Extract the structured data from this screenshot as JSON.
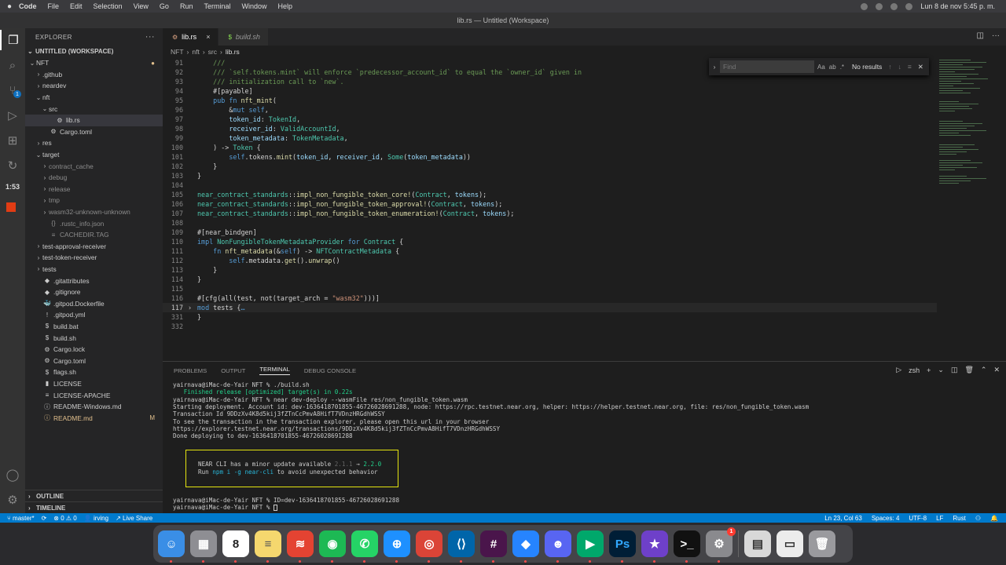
{
  "menubar": {
    "app": "Code",
    "items": [
      "File",
      "Edit",
      "Selection",
      "View",
      "Go",
      "Run",
      "Terminal",
      "Window",
      "Help"
    ],
    "clock": "Lun 8 de nov  5:45 p. m."
  },
  "window": {
    "title": "lib.rs — Untitled (Workspace)"
  },
  "activity": {
    "timer": "1:53",
    "scm_badge": "1"
  },
  "explorer": {
    "header": "EXPLORER",
    "workspace": "UNTITLED (WORKSPACE)",
    "tree": [
      {
        "label": "NFT",
        "indent": 0,
        "chev": "⌄",
        "icon": "",
        "mark": "●"
      },
      {
        "label": ".github",
        "indent": 1,
        "chev": "›",
        "icon": ""
      },
      {
        "label": "neardev",
        "indent": 1,
        "chev": "›",
        "icon": ""
      },
      {
        "label": "nft",
        "indent": 1,
        "chev": "⌄",
        "icon": ""
      },
      {
        "label": "src",
        "indent": 2,
        "chev": "⌄",
        "icon": ""
      },
      {
        "label": "lib.rs",
        "indent": 3,
        "chev": "",
        "icon": "⚙",
        "selected": true
      },
      {
        "label": "Cargo.toml",
        "indent": 2,
        "chev": "",
        "icon": "⚙"
      },
      {
        "label": "res",
        "indent": 1,
        "chev": "›",
        "icon": ""
      },
      {
        "label": "target",
        "indent": 1,
        "chev": "⌄",
        "icon": ""
      },
      {
        "label": "contract_cache",
        "indent": 2,
        "chev": "›",
        "icon": "",
        "dim": true
      },
      {
        "label": "debug",
        "indent": 2,
        "chev": "›",
        "icon": "",
        "dim": true
      },
      {
        "label": "release",
        "indent": 2,
        "chev": "›",
        "icon": "",
        "dim": true
      },
      {
        "label": "tmp",
        "indent": 2,
        "chev": "›",
        "icon": "",
        "dim": true
      },
      {
        "label": "wasm32-unknown-unknown",
        "indent": 2,
        "chev": "›",
        "icon": "",
        "dim": true
      },
      {
        "label": ".rustc_info.json",
        "indent": 2,
        "chev": "",
        "icon": "{}",
        "dim": true
      },
      {
        "label": "CACHEDIR.TAG",
        "indent": 2,
        "chev": "",
        "icon": "≡",
        "dim": true
      },
      {
        "label": "test-approval-receiver",
        "indent": 1,
        "chev": "›",
        "icon": ""
      },
      {
        "label": "test-token-receiver",
        "indent": 1,
        "chev": "›",
        "icon": ""
      },
      {
        "label": "tests",
        "indent": 1,
        "chev": "›",
        "icon": ""
      },
      {
        "label": ".gitattributes",
        "indent": 1,
        "chev": "",
        "icon": "◆"
      },
      {
        "label": ".gitignore",
        "indent": 1,
        "chev": "",
        "icon": "◆"
      },
      {
        "label": ".gitpod.Dockerfile",
        "indent": 1,
        "chev": "",
        "icon": "🐳"
      },
      {
        "label": ".gitpod.yml",
        "indent": 1,
        "chev": "",
        "icon": "!"
      },
      {
        "label": "build.bat",
        "indent": 1,
        "chev": "",
        "icon": "$"
      },
      {
        "label": "build.sh",
        "indent": 1,
        "chev": "",
        "icon": "$"
      },
      {
        "label": "Cargo.lock",
        "indent": 1,
        "chev": "",
        "icon": "⚙"
      },
      {
        "label": "Cargo.toml",
        "indent": 1,
        "chev": "",
        "icon": "⚙"
      },
      {
        "label": "flags.sh",
        "indent": 1,
        "chev": "",
        "icon": "$"
      },
      {
        "label": "LICENSE",
        "indent": 1,
        "chev": "",
        "icon": "▮"
      },
      {
        "label": "LICENSE-APACHE",
        "indent": 1,
        "chev": "",
        "icon": "≡"
      },
      {
        "label": "README-Windows.md",
        "indent": 1,
        "chev": "",
        "icon": "ⓘ"
      },
      {
        "label": "README.md",
        "indent": 1,
        "chev": "",
        "icon": "ⓘ",
        "mod": true,
        "mark": "M"
      }
    ],
    "outline": "OUTLINE",
    "timeline": "TIMELINE"
  },
  "editor": {
    "tabs": [
      {
        "label": "lib.rs",
        "active": true,
        "close": "×"
      },
      {
        "label": "build.sh",
        "active": false
      }
    ],
    "breadcrumb": [
      "NFT",
      "nft",
      "src",
      "lib.rs"
    ],
    "find": {
      "placeholder": "Find",
      "result": "No results",
      "opts": [
        "Aa",
        "ab",
        ".*"
      ]
    },
    "lines": [
      {
        "n": "91",
        "segs": [
          [
            "c-com",
            "    ///"
          ]
        ]
      },
      {
        "n": "92",
        "segs": [
          [
            "c-com",
            "    /// `self.tokens.mint` will enforce `predecessor_account_id` to equal the `owner_id` given in"
          ]
        ]
      },
      {
        "n": "93",
        "segs": [
          [
            "c-com",
            "    /// initialization call to `new`."
          ]
        ]
      },
      {
        "n": "94",
        "segs": [
          [
            "c-pl",
            "    #[payable]"
          ]
        ]
      },
      {
        "n": "95",
        "segs": [
          [
            "c-kw",
            "    pub fn "
          ],
          [
            "c-fn",
            "nft_mint"
          ],
          [
            "c-pl",
            "("
          ]
        ]
      },
      {
        "n": "96",
        "segs": [
          [
            "c-pl",
            "        &"
          ],
          [
            "c-kw",
            "mut self"
          ],
          [
            "c-pl",
            ","
          ]
        ]
      },
      {
        "n": "97",
        "segs": [
          [
            "c-var",
            "        token_id"
          ],
          [
            "c-pl",
            ": "
          ],
          [
            "c-ty",
            "TokenId"
          ],
          [
            "c-pl",
            ","
          ]
        ]
      },
      {
        "n": "98",
        "segs": [
          [
            "c-var",
            "        receiver_id"
          ],
          [
            "c-pl",
            ": "
          ],
          [
            "c-ty",
            "ValidAccountId"
          ],
          [
            "c-pl",
            ","
          ]
        ]
      },
      {
        "n": "99",
        "segs": [
          [
            "c-var",
            "        token_metadata"
          ],
          [
            "c-pl",
            ": "
          ],
          [
            "c-ty",
            "TokenMetadata"
          ],
          [
            "c-pl",
            ","
          ]
        ]
      },
      {
        "n": "100",
        "segs": [
          [
            "c-pl",
            "    ) -> "
          ],
          [
            "c-ty",
            "Token"
          ],
          [
            "c-pl",
            " {"
          ]
        ]
      },
      {
        "n": "101",
        "segs": [
          [
            "c-kw",
            "        self"
          ],
          [
            "c-pl",
            ".tokens."
          ],
          [
            "c-fn",
            "mint"
          ],
          [
            "c-pl",
            "("
          ],
          [
            "c-var",
            "token_id"
          ],
          [
            "c-pl",
            ", "
          ],
          [
            "c-var",
            "receiver_id"
          ],
          [
            "c-pl",
            ", "
          ],
          [
            "c-ty",
            "Some"
          ],
          [
            "c-pl",
            "("
          ],
          [
            "c-var",
            "token_metadata"
          ],
          [
            "c-pl",
            "))"
          ]
        ]
      },
      {
        "n": "102",
        "segs": [
          [
            "c-pl",
            "    }"
          ]
        ]
      },
      {
        "n": "103",
        "segs": [
          [
            "c-pl",
            "}"
          ]
        ]
      },
      {
        "n": "104",
        "segs": []
      },
      {
        "n": "105",
        "segs": [
          [
            "c-ty",
            "near_contract_standards"
          ],
          [
            "c-pl",
            "::"
          ],
          [
            "c-fn",
            "impl_non_fungible_token_core!"
          ],
          [
            "c-pl",
            "("
          ],
          [
            "c-ty",
            "Contract"
          ],
          [
            "c-pl",
            ", "
          ],
          [
            "c-var",
            "tokens"
          ],
          [
            "c-pl",
            ");"
          ]
        ]
      },
      {
        "n": "106",
        "segs": [
          [
            "c-ty",
            "near_contract_standards"
          ],
          [
            "c-pl",
            "::"
          ],
          [
            "c-fn",
            "impl_non_fungible_token_approval!"
          ],
          [
            "c-pl",
            "("
          ],
          [
            "c-ty",
            "Contract"
          ],
          [
            "c-pl",
            ", "
          ],
          [
            "c-var",
            "tokens"
          ],
          [
            "c-pl",
            ");"
          ]
        ]
      },
      {
        "n": "107",
        "segs": [
          [
            "c-ty",
            "near_contract_standards"
          ],
          [
            "c-pl",
            "::"
          ],
          [
            "c-fn",
            "impl_non_fungible_token_enumeration!"
          ],
          [
            "c-pl",
            "("
          ],
          [
            "c-ty",
            "Contract"
          ],
          [
            "c-pl",
            ", "
          ],
          [
            "c-var",
            "tokens"
          ],
          [
            "c-pl",
            ");"
          ]
        ]
      },
      {
        "n": "108",
        "segs": []
      },
      {
        "n": "109",
        "segs": [
          [
            "c-pl",
            "#[near_bindgen]"
          ]
        ]
      },
      {
        "n": "110",
        "segs": [
          [
            "c-kw",
            "impl "
          ],
          [
            "c-ty",
            "NonFungibleTokenMetadataProvider"
          ],
          [
            "c-kw",
            " for "
          ],
          [
            "c-ty",
            "Contract"
          ],
          [
            "c-pl",
            " {"
          ]
        ]
      },
      {
        "n": "111",
        "segs": [
          [
            "c-kw",
            "    fn "
          ],
          [
            "c-fn",
            "nft_metadata"
          ],
          [
            "c-pl",
            "(&"
          ],
          [
            "c-kw",
            "self"
          ],
          [
            "c-pl",
            ") -> "
          ],
          [
            "c-ty",
            "NFTContractMetadata"
          ],
          [
            "c-pl",
            " {"
          ]
        ]
      },
      {
        "n": "112",
        "segs": [
          [
            "c-kw",
            "        self"
          ],
          [
            "c-pl",
            ".metadata."
          ],
          [
            "c-fn",
            "get"
          ],
          [
            "c-pl",
            "()."
          ],
          [
            "c-fn",
            "unwrap"
          ],
          [
            "c-pl",
            "()"
          ]
        ]
      },
      {
        "n": "113",
        "segs": [
          [
            "c-pl",
            "    }"
          ]
        ]
      },
      {
        "n": "114",
        "segs": [
          [
            "c-pl",
            "}"
          ]
        ]
      },
      {
        "n": "115",
        "segs": []
      },
      {
        "n": "116",
        "segs": [
          [
            "c-pl",
            "#[cfg(all(test, not(target_arch = "
          ],
          [
            "c-str",
            "\"wasm32\""
          ],
          [
            "c-pl",
            ")))]"
          ]
        ]
      },
      {
        "n": "117",
        "segs": [
          [
            "c-kw",
            "mod "
          ],
          [
            "c-pl",
            "tests {"
          ],
          [
            "c-fold",
            "…"
          ]
        ],
        "current": true,
        "fold": "›"
      },
      {
        "n": "331",
        "segs": [
          [
            "c-pl",
            "}"
          ]
        ]
      },
      {
        "n": "332",
        "segs": []
      }
    ]
  },
  "panel": {
    "tabs": [
      "PROBLEMS",
      "OUTPUT",
      "TERMINAL",
      "DEBUG CONSOLE"
    ],
    "active_tab": "TERMINAL",
    "shell": "zsh",
    "terminal": [
      "yairnava@iMac-de-Yair NFT % ./build.sh",
      "   Finished release [optimized] target(s) in 0.22s",
      "yairnava@iMac-de-Yair NFT % near dev-deploy --wasmFile res/non_fungible_token.wasm",
      "Starting deployment. Account id: dev-1636418701855-46726028691288, node: https://rpc.testnet.near.org, helper: https://helper.testnet.near.org, file: res/non_fungible_token.wasm",
      "Transaction Id 9DDzXv4K8d5kij3fZTnCcPmvA8HifT7VDnzHRGdhWSSY",
      "To see the transaction in the transaction explorer, please open this url in your browser",
      "https://explorer.testnet.near.org/transactions/9DDzXv4K8d5kij3fZTnCcPmvA8HifT7VDnzHRGdhWSSY",
      "Done deploying to dev-1636418701855-46726028691288"
    ],
    "notice": {
      "line1_pre": "NEAR CLI has a minor update available ",
      "old": "2.1.1",
      "arrow": " → ",
      "new": "2.2.0",
      "line2_pre": "Run ",
      "cmd": "npm i -g near-cli",
      "line2_post": " to avoid unexpected behavior"
    },
    "after": [
      "yairnava@iMac-de-Yair NFT % ID=dev-1636418701855-46726028691288",
      "yairnava@iMac-de-Yair NFT % "
    ]
  },
  "status": {
    "branch": "master*",
    "sync": "⟳",
    "errors": "⊗ 0",
    "warnings": "⚠ 0",
    "user": "irving",
    "live": "Live Share",
    "position": "Ln 23, Col 63",
    "spaces": "Spaces: 4",
    "encoding": "UTF-8",
    "eol": "LF",
    "language": "Rust"
  },
  "dock": {
    "apps": [
      {
        "name": "finder",
        "bg": "#3a8ee6",
        "glyph": "☺"
      },
      {
        "name": "launchpad",
        "bg": "#8e8e93",
        "glyph": "▦"
      },
      {
        "name": "calendar",
        "bg": "#ffffff",
        "glyph": "8",
        "fg": "#222"
      },
      {
        "name": "notes",
        "bg": "#f5d76e",
        "glyph": "≡",
        "fg": "#555"
      },
      {
        "name": "todoist",
        "bg": "#e44332",
        "glyph": "≋"
      },
      {
        "name": "spotify",
        "bg": "#1db954",
        "glyph": "◉"
      },
      {
        "name": "whatsapp",
        "bg": "#25d366",
        "glyph": "✆"
      },
      {
        "name": "safari",
        "bg": "#1e90ff",
        "glyph": "⊕"
      },
      {
        "name": "chrome",
        "bg": "#db4437",
        "glyph": "◎"
      },
      {
        "name": "vscode",
        "bg": "#0065a9",
        "glyph": "⟨⟩"
      },
      {
        "name": "slack",
        "bg": "#4a154b",
        "glyph": "#"
      },
      {
        "name": "jira",
        "bg": "#2684ff",
        "glyph": "◆"
      },
      {
        "name": "discord",
        "bg": "#5865f2",
        "glyph": "☻"
      },
      {
        "name": "meet",
        "bg": "#00a86b",
        "glyph": "▶"
      },
      {
        "name": "photoshop",
        "bg": "#001e36",
        "glyph": "Ps",
        "fg": "#31a8ff"
      },
      {
        "name": "imovie",
        "bg": "#6e40c9",
        "glyph": "★"
      },
      {
        "name": "terminal",
        "bg": "#111111",
        "glyph": ">_"
      },
      {
        "name": "settings",
        "bg": "#8a8a8e",
        "glyph": "⚙",
        "badge": "1"
      },
      {
        "name": "documents",
        "bg": "#d8d8d8",
        "glyph": "▤",
        "fg": "#333"
      },
      {
        "name": "preview",
        "bg": "#ececec",
        "glyph": "▭",
        "fg": "#333"
      },
      {
        "name": "trash",
        "bg": "#9a9a9e",
        "glyph": "🗑"
      }
    ]
  }
}
